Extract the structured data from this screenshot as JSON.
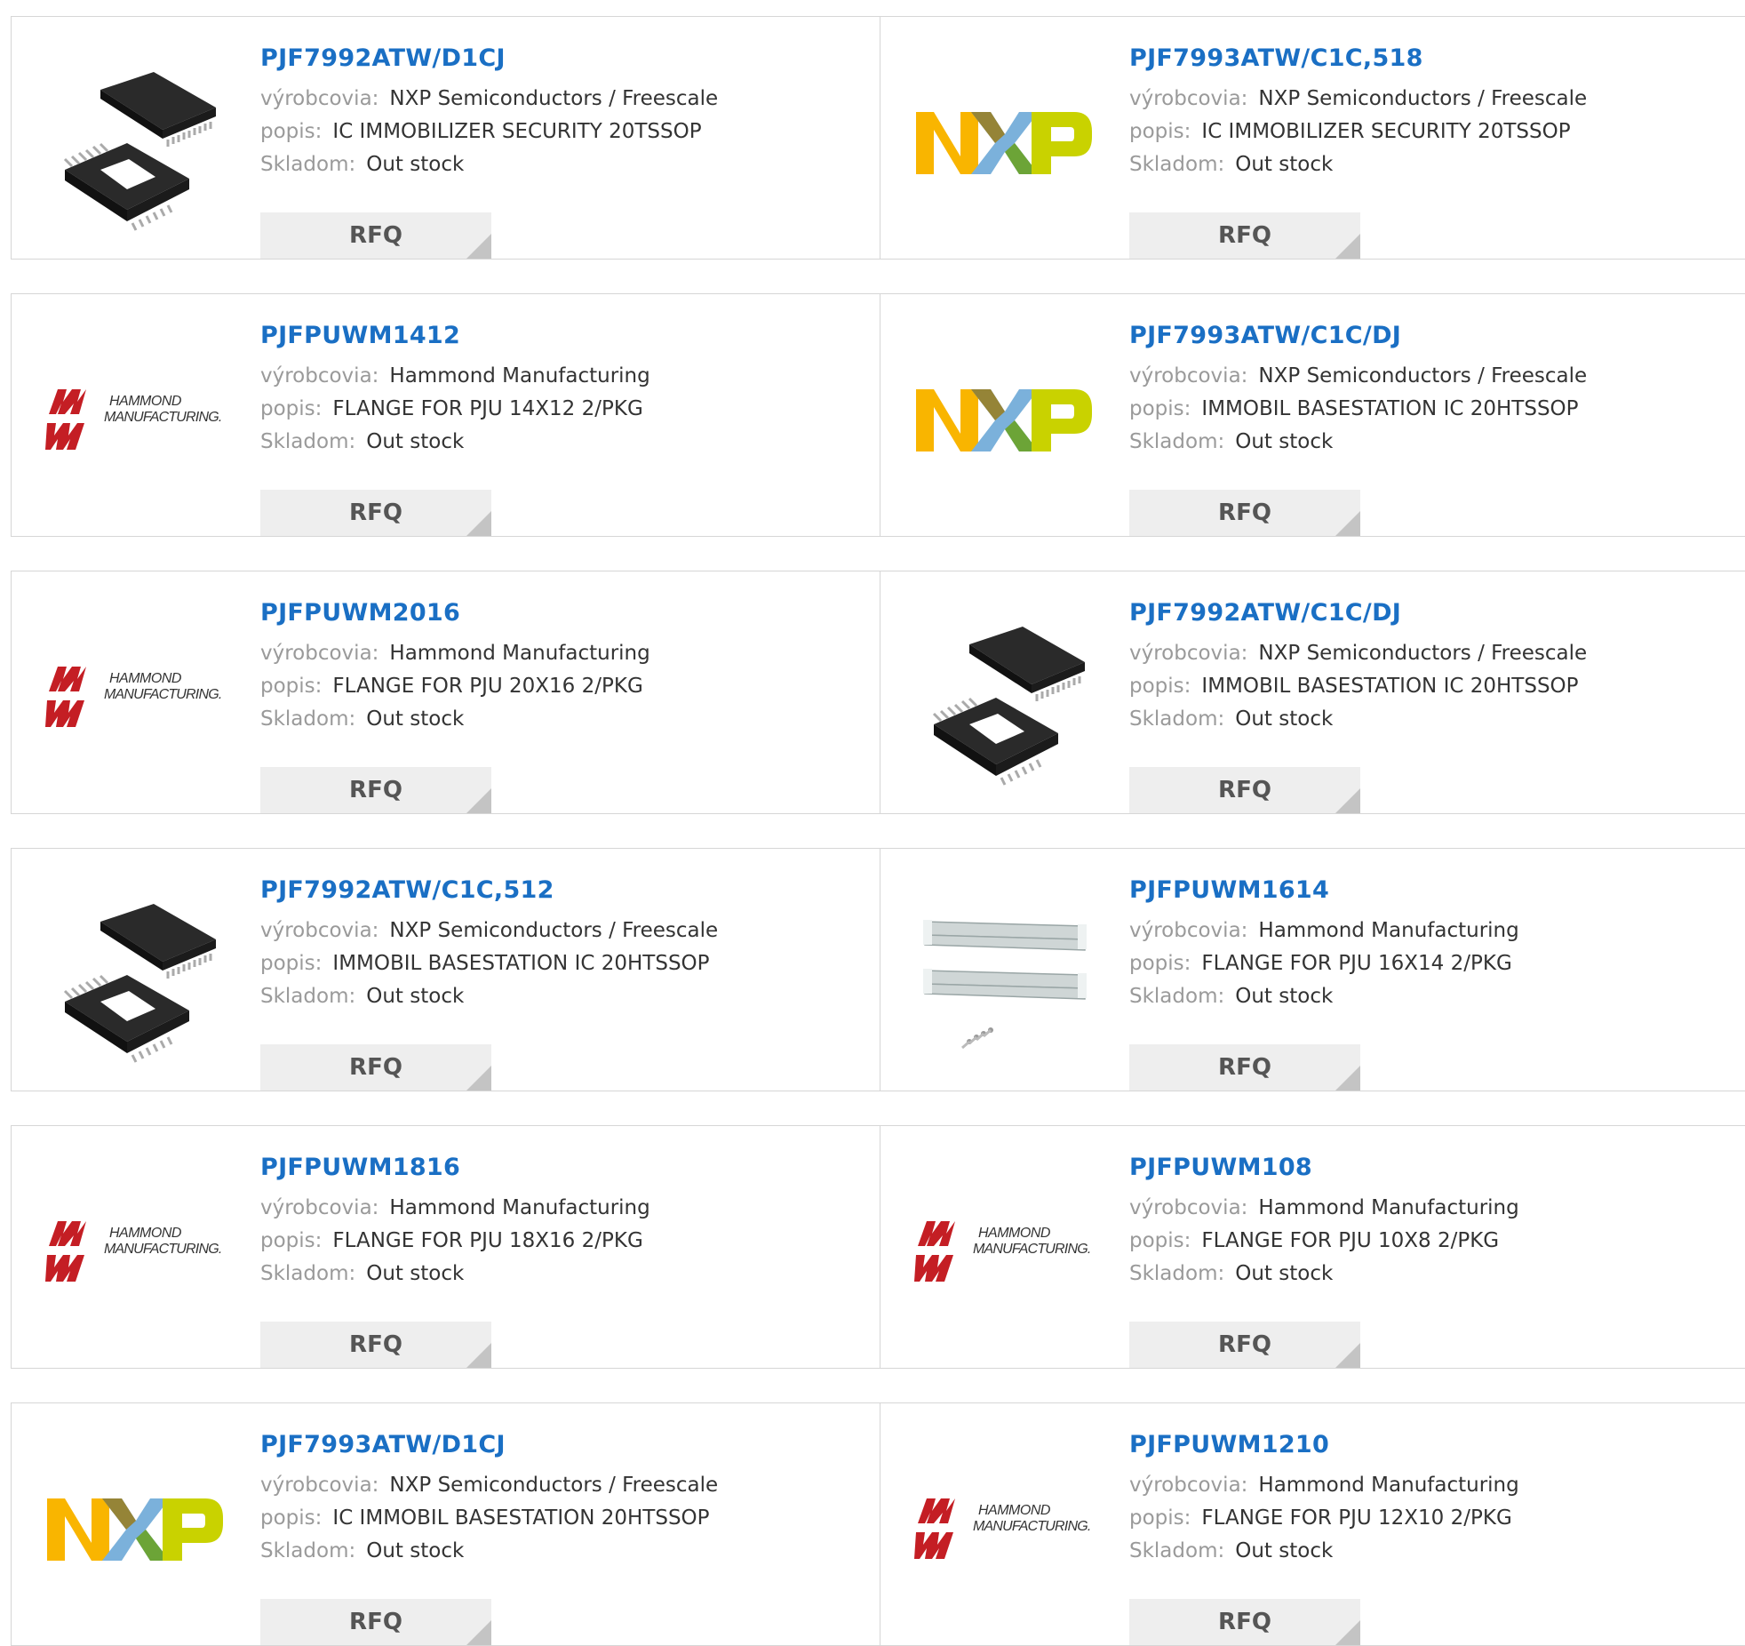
{
  "labels": {
    "manufacturer": "výrobcovia:",
    "description": "popis:",
    "stock": "Skladom:",
    "rfq": "RFQ"
  },
  "colors": {
    "part_link": "#1a6fc4",
    "label": "#9a9a9a",
    "value": "#333333",
    "button_bg": "#eeeeee",
    "hammond_red": "#c41e24"
  },
  "products": [
    {
      "part": "PJF7992ATW/D1CJ",
      "manufacturer": "NXP Semiconductors / Freescale",
      "description": "IC IMMOBILIZER SECURITY 20TSSOP",
      "stock": "Out stock",
      "image": "tssop-chip-icon"
    },
    {
      "part": "PJF7993ATW/C1C,518",
      "manufacturer": "NXP Semiconductors / Freescale",
      "description": "IC IMMOBILIZER SECURITY 20TSSOP",
      "stock": "Out stock",
      "image": "nxp-logo"
    },
    {
      "part": "PJFPUWM1412",
      "manufacturer": "Hammond Manufacturing",
      "description": "FLANGE FOR PJU 14X12 2/PKG",
      "stock": "Out stock",
      "image": "hammond-logo"
    },
    {
      "part": "PJF7993ATW/C1C/DJ",
      "manufacturer": "NXP Semiconductors / Freescale",
      "description": "IMMOBIL BASESTATION IC 20HTSSOP",
      "stock": "Out stock",
      "image": "nxp-logo"
    },
    {
      "part": "PJFPUWM2016",
      "manufacturer": "Hammond Manufacturing",
      "description": "FLANGE FOR PJU 20X16 2/PKG",
      "stock": "Out stock",
      "image": "hammond-logo"
    },
    {
      "part": "PJF7992ATW/C1C/DJ",
      "manufacturer": "NXP Semiconductors / Freescale",
      "description": "IMMOBIL BASESTATION IC 20HTSSOP",
      "stock": "Out stock",
      "image": "tssop-chip-icon"
    },
    {
      "part": "PJF7992ATW/C1C,512",
      "manufacturer": "NXP Semiconductors / Freescale",
      "description": "IMMOBIL BASESTATION IC 20HTSSOP",
      "stock": "Out stock",
      "image": "tssop-chip-icon"
    },
    {
      "part": "PJFPUWM1614",
      "manufacturer": "Hammond Manufacturing",
      "description": "FLANGE FOR PJU 16X14 2/PKG",
      "stock": "Out stock",
      "image": "flange-rails-icon"
    },
    {
      "part": "PJFPUWM1816",
      "manufacturer": "Hammond Manufacturing",
      "description": "FLANGE FOR PJU 18X16 2/PKG",
      "stock": "Out stock",
      "image": "hammond-logo"
    },
    {
      "part": "PJFPUWM108",
      "manufacturer": "Hammond Manufacturing",
      "description": "FLANGE FOR PJU 10X8 2/PKG",
      "stock": "Out stock",
      "image": "hammond-logo"
    },
    {
      "part": "PJF7993ATW/D1CJ",
      "manufacturer": "NXP Semiconductors / Freescale",
      "description": "IC IMMOBIL BASESTATION 20HTSSOP",
      "stock": "Out stock",
      "image": "nxp-logo"
    },
    {
      "part": "PJFPUWM1210",
      "manufacturer": "Hammond Manufacturing",
      "description": "FLANGE FOR PJU 12X10 2/PKG",
      "stock": "Out stock",
      "image": "hammond-logo"
    }
  ]
}
